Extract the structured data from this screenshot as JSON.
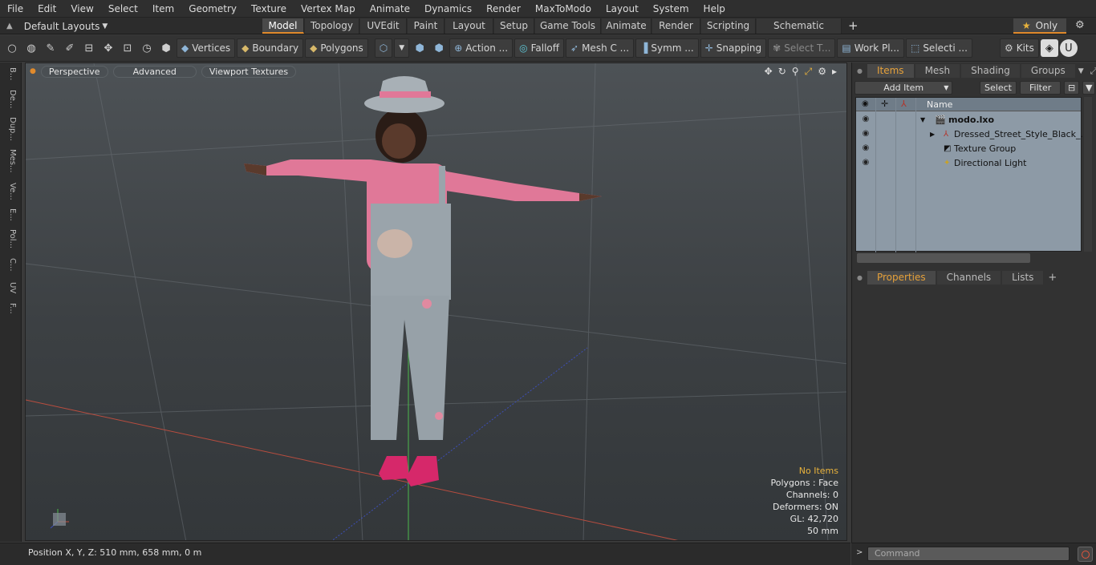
{
  "menu": [
    "File",
    "Edit",
    "View",
    "Select",
    "Item",
    "Geometry",
    "Texture",
    "Vertex Map",
    "Animate",
    "Dynamics",
    "Render",
    "MaxToModo",
    "Layout",
    "System",
    "Help"
  ],
  "layout_dropdown": "Default Layouts",
  "tabs": [
    "Model",
    "Topology",
    "UVEdit",
    "Paint",
    "Layout",
    "Setup",
    "Game Tools",
    "Animate",
    "Render",
    "Scripting",
    "Schematic Fusion"
  ],
  "active_tab": "Model",
  "only_label": "Only",
  "toolbar": {
    "vertices": "Vertices",
    "boundary": "Boundary",
    "polygons": "Polygons",
    "action": "Action ...",
    "falloff": "Falloff",
    "mesh": "Mesh C ...",
    "symm": "Symm ...",
    "snapping": "Snapping",
    "select_t": "Select T...",
    "work_pl": "Work Pl...",
    "selecti": "Selecti ...",
    "kits": "Kits"
  },
  "left_tabs": [
    "B...",
    "De...",
    "Dup...",
    "Mes...",
    "Ve...",
    "E...",
    "Pol...",
    "C...",
    "UV",
    "F..."
  ],
  "viewport": {
    "perspective": "Perspective",
    "advanced": "Advanced",
    "textures": "Viewport Textures"
  },
  "vp_info": {
    "selection": "No Items",
    "polygons": "Polygons : Face",
    "channels": "Channels: 0",
    "deformers": "Deformers: ON",
    "gl": "GL: 42,720",
    "distance": "50 mm"
  },
  "status_text": "Position X, Y, Z:   510 mm, 658 mm, 0 m",
  "items_panel": {
    "tabs": [
      "Items",
      "Mesh ...",
      "Shading",
      "Groups"
    ],
    "add_item": "Add Item",
    "select": "Select",
    "filter": "Filter",
    "name_col": "Name",
    "rows": [
      "modo.lxo",
      "Dressed_Street_Style_Black_...",
      "Texture Group",
      "Directional Light"
    ]
  },
  "props_panel": {
    "tabs": [
      "Properties",
      "Channels",
      "Lists"
    ]
  },
  "command_placeholder": "Command",
  "colors": {
    "accent": "#e08a2c",
    "items_bg": "#8d9aa6",
    "viewport_top": "#4d5256"
  }
}
